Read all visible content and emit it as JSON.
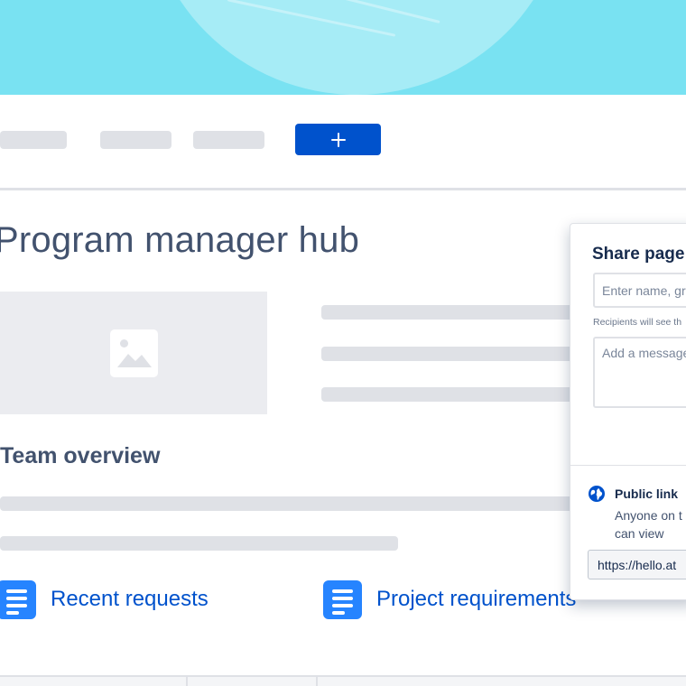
{
  "toolbar": {
    "create_button": {
      "icon": "plus-icon"
    }
  },
  "page": {
    "title": "Program manager hub",
    "section_title": "Team overview",
    "image_placeholder_icon": "image-icon"
  },
  "links": [
    {
      "label": "Recent requests",
      "icon": "document-icon"
    },
    {
      "label": "Project requirements",
      "icon": "document-icon"
    }
  ],
  "share": {
    "title": "Share page",
    "recipients_placeholder": "Enter name, gr",
    "hint": "Recipients will see th",
    "message_placeholder": "Add a message",
    "public_link": {
      "title": "Public link",
      "description": "Anyone on t link can view",
      "url": "https://hello.at",
      "icon": "globe-icon"
    }
  },
  "colors": {
    "hero": "#79e2f2",
    "primary": "#0052cc",
    "doc_icon": "#2684ff",
    "heading": "#42526e",
    "placeholder": "#dfe1e6"
  }
}
